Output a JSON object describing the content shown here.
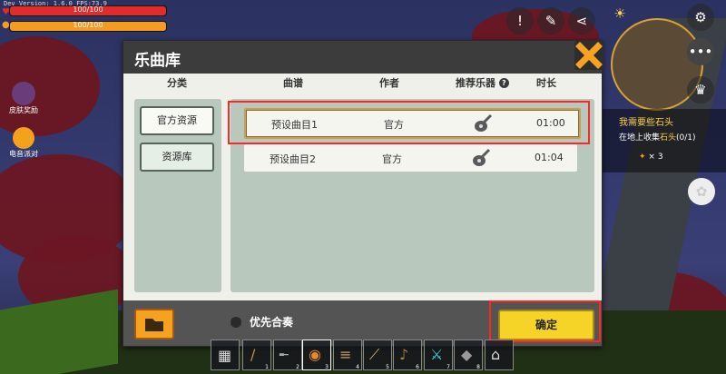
{
  "hud": {
    "dev_version": "Dev Version: 1.6.0  FPS:73.9",
    "health_text": "100/100",
    "hunger_text": "100/100",
    "health_fraction": 1.0,
    "hunger_fraction": 1.0,
    "health_color": "#e32b2b",
    "hunger_color": "#f59b22"
  },
  "right_buttons": [
    "alert-icon",
    "chat-icon",
    "share-icon",
    "sun-icon",
    "settings-icon",
    "more-icon",
    "trophy-icon",
    "pet-icon"
  ],
  "task": {
    "title": "我需要些石头",
    "desc_prefix": "在地上收集",
    "desc_item": "石头",
    "desc_count": "(0/1)",
    "reward": "× 3"
  },
  "side": {
    "skin_reward": "皮肤奖励",
    "party": "电音派对"
  },
  "dialog": {
    "title": "乐曲库",
    "columns": {
      "category": "分类",
      "score": "曲谱",
      "author": "作者",
      "instrument": "推荐乐器",
      "duration": "时长",
      "help": "?"
    },
    "categories": [
      {
        "label": "官方资源",
        "selected": false
      },
      {
        "label": "资源库",
        "selected": true
      }
    ],
    "songs": [
      {
        "name": "预设曲目1",
        "author": "官方",
        "instrument": "lute-icon",
        "duration": "01:00",
        "selected": true
      },
      {
        "name": "预设曲目2",
        "author": "官方",
        "instrument": "lute-icon",
        "duration": "01:04",
        "selected": false
      }
    ],
    "priority_label": "优先合奏",
    "confirm_label": "确定"
  },
  "hotbar": {
    "slots": [
      {
        "icon": "craft-table-icon",
        "num": ""
      },
      {
        "icon": "stick-icon",
        "num": "1"
      },
      {
        "icon": "gun-icon",
        "num": "2"
      },
      {
        "icon": "drum-icon",
        "num": "3"
      },
      {
        "icon": "bamboo-flute-icon",
        "num": "4"
      },
      {
        "icon": "trumpet-icon",
        "num": "5"
      },
      {
        "icon": "lute-icon",
        "num": "6"
      },
      {
        "icon": "sword-icon",
        "num": "7"
      },
      {
        "icon": "stone-icon",
        "num": "8"
      },
      {
        "icon": "backpack-icon",
        "num": ""
      }
    ]
  }
}
